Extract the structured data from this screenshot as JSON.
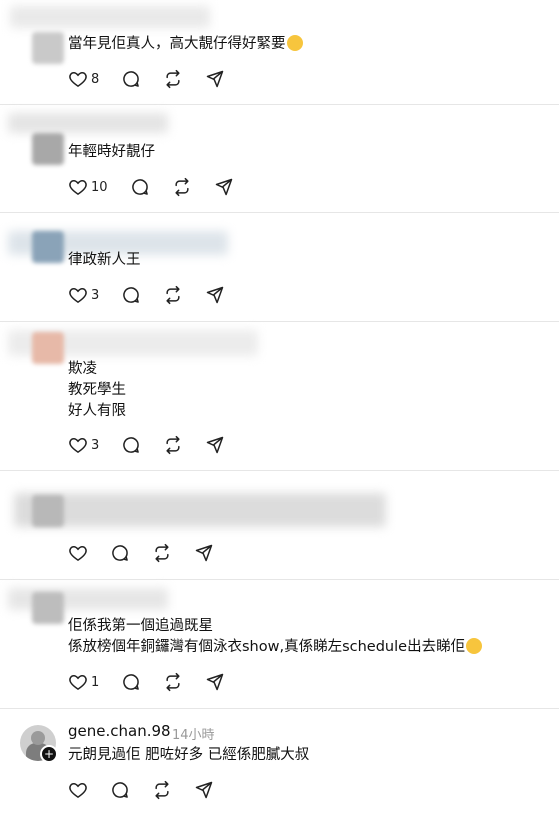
{
  "comments": [
    {
      "lines": [
        "當年見佢真人，高大靚仔得好緊要"
      ],
      "has_emoji": true,
      "likes": "8"
    },
    {
      "lines": [
        "年輕時好靚仔"
      ],
      "has_emoji": false,
      "likes": "10"
    },
    {
      "lines": [
        "律政新人王"
      ],
      "has_emoji": false,
      "likes": "3"
    },
    {
      "lines": [
        "欺凌",
        "教死學生",
        "好人有限"
      ],
      "has_emoji": false,
      "likes": "3"
    },
    {
      "lines": [],
      "has_emoji": false,
      "likes": ""
    },
    {
      "lines": [
        "佢係我第一個追過既星",
        "係放榜個年銅鑼灣有個泳衣show,真係睇左schedule出去睇佢"
      ],
      "has_emoji": true,
      "likes": "1"
    },
    {
      "username": "gene.chan.98",
      "time": "14小時",
      "lines": [
        "元朗見過佢 肥咗好多 已經係肥膩大叔"
      ],
      "has_emoji": false,
      "likes": ""
    }
  ],
  "icons": {
    "like": "heart-icon",
    "reply": "comment-icon",
    "repost": "repost-icon",
    "share": "send-icon"
  },
  "colors": {
    "text": "#111111",
    "muted": "#999999",
    "divider": "#e6e6e6",
    "emoji": "#f7c53d"
  }
}
